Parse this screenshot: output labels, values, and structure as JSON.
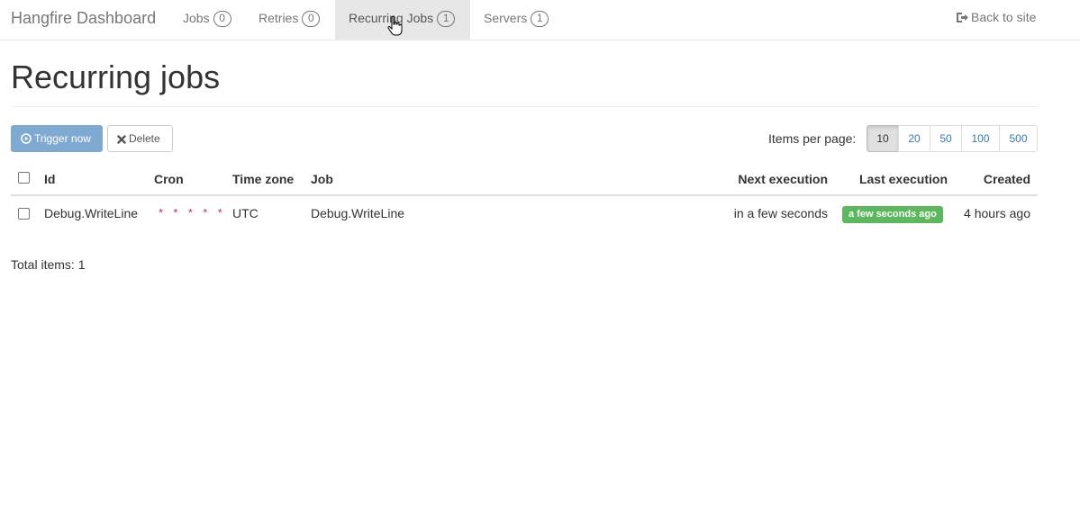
{
  "navbar": {
    "brand": "Hangfire Dashboard",
    "items": [
      {
        "label": "Jobs",
        "count": "0"
      },
      {
        "label": "Retries",
        "count": "0"
      },
      {
        "label": "Recurring Jobs",
        "count": "1"
      },
      {
        "label": "Servers",
        "count": "1"
      }
    ],
    "active_item": "Recurring Jobs",
    "back_label": "Back to site"
  },
  "page": {
    "title": "Recurring jobs"
  },
  "toolbar": {
    "trigger_label": "Trigger now",
    "delete_label": "Delete",
    "per_page_label": "Items per page:",
    "per_page_options": [
      "10",
      "20",
      "50",
      "100",
      "500"
    ],
    "per_page_selected": "10"
  },
  "table": {
    "columns": [
      "Id",
      "Cron",
      "Time zone",
      "Job",
      "Next execution",
      "Last execution",
      "Created"
    ],
    "rows": [
      {
        "id": "Debug.WriteLine",
        "cron": "* * * * *",
        "time_zone": "UTC",
        "job": "Debug.WriteLine",
        "next_execution": "in a few seconds",
        "last_execution": "a few seconds ago",
        "created": "4 hours ago"
      }
    ]
  },
  "footer": {
    "total_items": "Total items: 1"
  },
  "colors": {
    "primary_button": "#7ea9d1",
    "success_label": "#5cb85c",
    "cron_text": "#c7254e",
    "link": "#337ab7"
  }
}
